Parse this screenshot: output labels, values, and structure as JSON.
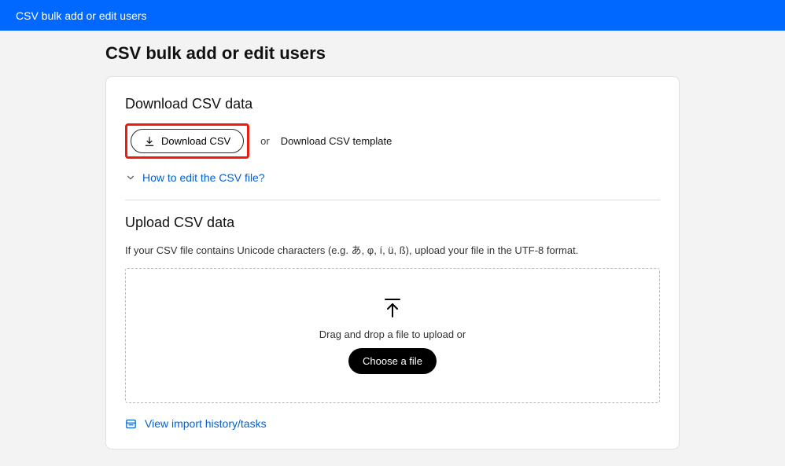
{
  "topbar": {
    "title": "CSV bulk add or edit users"
  },
  "page": {
    "title": "CSV bulk add or edit users"
  },
  "download_section": {
    "title": "Download CSV data",
    "download_button": "Download CSV",
    "or": "or",
    "template_link": "Download CSV template",
    "howto_link": "How to edit the CSV file?"
  },
  "upload_section": {
    "title": "Upload CSV data",
    "hint": "If your CSV file contains Unicode characters (e.g. あ, φ, í, ü, ß), upload your file in the UTF-8 format.",
    "drop_text": "Drag and drop a file to upload or",
    "choose_button": "Choose a file"
  },
  "footer": {
    "history_link": "View import history/tasks"
  }
}
